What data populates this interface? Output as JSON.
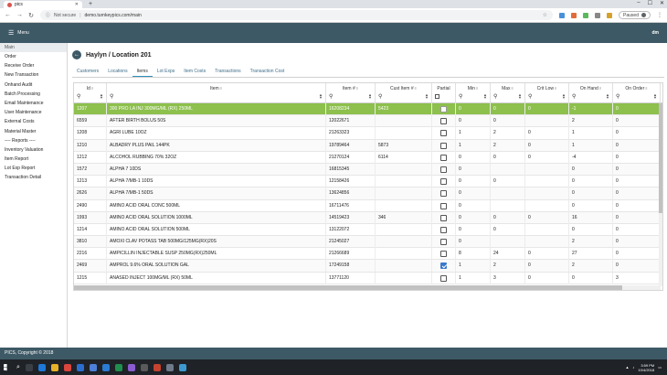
{
  "browser": {
    "tab_title": "pics",
    "new_tab_icon": "+",
    "security": "Not secure",
    "url": "demo.turnkeypics.com/main",
    "paused_label": "Paused"
  },
  "app": {
    "menu_label": "Menu",
    "user_initials": "dm",
    "footer": "PICS, Copyright © 2018"
  },
  "sidebar": {
    "section_label": "Main",
    "items": [
      "Order",
      "Receive Order",
      "New Transaction",
      "Onhand Audit",
      "Batch Processing",
      "Email Maintenance",
      "User Maintenance",
      "External Costs",
      "Material Master",
      "---- Reports ----",
      "Inventory Valuation",
      "Item Report",
      "Lot Exp Report",
      "Transaction Detail"
    ]
  },
  "page": {
    "title": "Haylyn / Location 201",
    "tabs": [
      "Customers",
      "Locations",
      "Items",
      "Lot Exps",
      "Item Costs",
      "Transactions",
      "Transaction Cost"
    ],
    "active_tab": "Items"
  },
  "grid": {
    "columns": [
      "Id",
      "Item",
      "Item #",
      "Cust Item #",
      "Partial",
      "Min",
      "Max",
      "Crit Low",
      "On Hand",
      "On Order"
    ],
    "rows": [
      {
        "id": "1207",
        "item": "300 PRO LA INJ 300MG/ML (RX) 250ML",
        "item_no": "16208234",
        "cust_item": "5423",
        "partial": false,
        "min": "0",
        "max": "0",
        "crit": "0",
        "onhand": "-1",
        "onorder": "0"
      },
      {
        "id": "6559",
        "item": "AFTER BIRTH BOLUS 50S",
        "item_no": "12022671",
        "cust_item": "",
        "partial": false,
        "min": "0",
        "max": "0",
        "crit": "",
        "onhand": "2",
        "onorder": "0"
      },
      {
        "id": "1208",
        "item": "AGRI LUBE 10OZ",
        "item_no": "21263323",
        "cust_item": "",
        "partial": false,
        "min": "1",
        "max": "2",
        "crit": "0",
        "onhand": "1",
        "onorder": "0"
      },
      {
        "id": "1210",
        "item": "ALBADRY PLUS PAIL 144PK",
        "item_no": "19789464",
        "cust_item": "5873",
        "partial": false,
        "min": "1",
        "max": "2",
        "crit": "0",
        "onhand": "1",
        "onorder": "0"
      },
      {
        "id": "1212",
        "item": "ALCOHOL RUBBING 70% 32OZ",
        "item_no": "21270124",
        "cust_item": "6114",
        "partial": false,
        "min": "0",
        "max": "0",
        "crit": "0",
        "onhand": "-4",
        "onorder": "0"
      },
      {
        "id": "1572",
        "item": "ALPHA 7 10DS",
        "item_no": "16815345",
        "cust_item": "",
        "partial": false,
        "min": "0",
        "max": "",
        "crit": "",
        "onhand": "0",
        "onorder": "0"
      },
      {
        "id": "1213",
        "item": "ALPHA 7/MB-1 10DS",
        "item_no": "12158426",
        "cust_item": "",
        "partial": false,
        "min": "0",
        "max": "0",
        "crit": "",
        "onhand": "0",
        "onorder": "0"
      },
      {
        "id": "2626",
        "item": "ALPHA 7/MB-1 50DS",
        "item_no": "13624856",
        "cust_item": "",
        "partial": false,
        "min": "0",
        "max": "",
        "crit": "",
        "onhand": "0",
        "onorder": "0"
      },
      {
        "id": "2490",
        "item": "AMINO ACID ORAL CONC 500ML",
        "item_no": "16711476",
        "cust_item": "",
        "partial": false,
        "min": "0",
        "max": "",
        "crit": "",
        "onhand": "0",
        "onorder": "0"
      },
      {
        "id": "1993",
        "item": "AMINO ACID ORAL SOLUTION 1000ML",
        "item_no": "14519423",
        "cust_item": "346",
        "partial": false,
        "min": "0",
        "max": "0",
        "crit": "0",
        "onhand": "16",
        "onorder": "0"
      },
      {
        "id": "1214",
        "item": "AMINO ACID ORAL SOLUTION 500ML",
        "item_no": "13122072",
        "cust_item": "",
        "partial": false,
        "min": "0",
        "max": "0",
        "crit": "",
        "onhand": "0",
        "onorder": "0"
      },
      {
        "id": "3810",
        "item": "AMOXI CLAV POTASS TAB 500MG/125MG(RX)20S",
        "item_no": "21245027",
        "cust_item": "",
        "partial": false,
        "min": "0",
        "max": "",
        "crit": "",
        "onhand": "2",
        "onorder": "0"
      },
      {
        "id": "2216",
        "item": "AMPICILLIN INJECTABLE SUSP 250MG(RX)250ML",
        "item_no": "21266689",
        "cust_item": "",
        "partial": false,
        "min": "8",
        "max": "24",
        "crit": "0",
        "onhand": "27",
        "onorder": "0"
      },
      {
        "id": "2469",
        "item": "AMPROL 9.6% ORAL SOLUTION GAL",
        "item_no": "17249158",
        "cust_item": "",
        "partial": true,
        "min": "1",
        "max": "2",
        "crit": "0",
        "onhand": "2",
        "onorder": "0"
      },
      {
        "id": "1215",
        "item": "ANASED INJECT 100MG/ML (RX) 50ML",
        "item_no": "13771120",
        "cust_item": "",
        "partial": false,
        "min": "1",
        "max": "3",
        "crit": "0",
        "onhand": "0",
        "onorder": "3"
      }
    ]
  },
  "taskbar": {
    "time": "3:59 PM",
    "date": "10/4/2018"
  },
  "colors": {
    "header": "#3e5966",
    "selected_row": "#8dc04d",
    "tab_link": "#3d6d8a"
  }
}
